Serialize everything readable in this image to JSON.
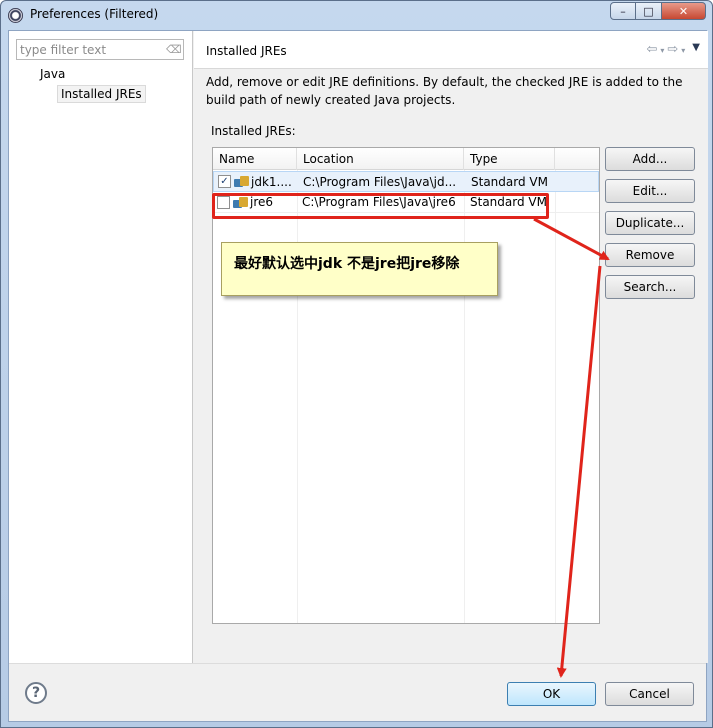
{
  "window": {
    "title": "Preferences (Filtered)",
    "min_glyph": "–",
    "max_glyph": "□",
    "close_glyph": "✕"
  },
  "sidebar": {
    "filter_placeholder": "type filter text",
    "tree": [
      {
        "label": "Java"
      },
      {
        "label": "Installed JREs",
        "selected": true
      }
    ]
  },
  "page": {
    "title": "Installed JREs",
    "description": "Add, remove or edit JRE definitions. By default, the checked JRE is added to the build path of newly created Java projects.",
    "list_label": "Installed JREs:",
    "nav": {
      "back": "⇦",
      "forward": "⇨",
      "dropdown": "▾",
      "menu": "▼"
    }
  },
  "table": {
    "columns": [
      "Name",
      "Location",
      "Type"
    ],
    "rows": [
      {
        "checked": true,
        "check_glyph": "✓",
        "name": "jdk1....",
        "location": "C:\\Program Files\\Java\\jd...",
        "type": "Standard VM"
      },
      {
        "checked": false,
        "check_glyph": "",
        "name": "jre6",
        "location": "C:\\Program Files\\Java\\jre6",
        "type": "Standard VM"
      }
    ]
  },
  "buttons": {
    "add": "Add...",
    "edit": "Edit...",
    "duplicate": "Duplicate...",
    "remove": "Remove",
    "search": "Search...",
    "ok": "OK",
    "cancel": "Cancel",
    "help": "?"
  },
  "annotation": {
    "callout_text": "最好默认选中jdk 不是jre把jre移除",
    "color": "#e0241b"
  },
  "colors": {
    "accent_red": "#e0241b",
    "callout_bg": "#ffffc8",
    "selection": "#e8f1fb"
  }
}
